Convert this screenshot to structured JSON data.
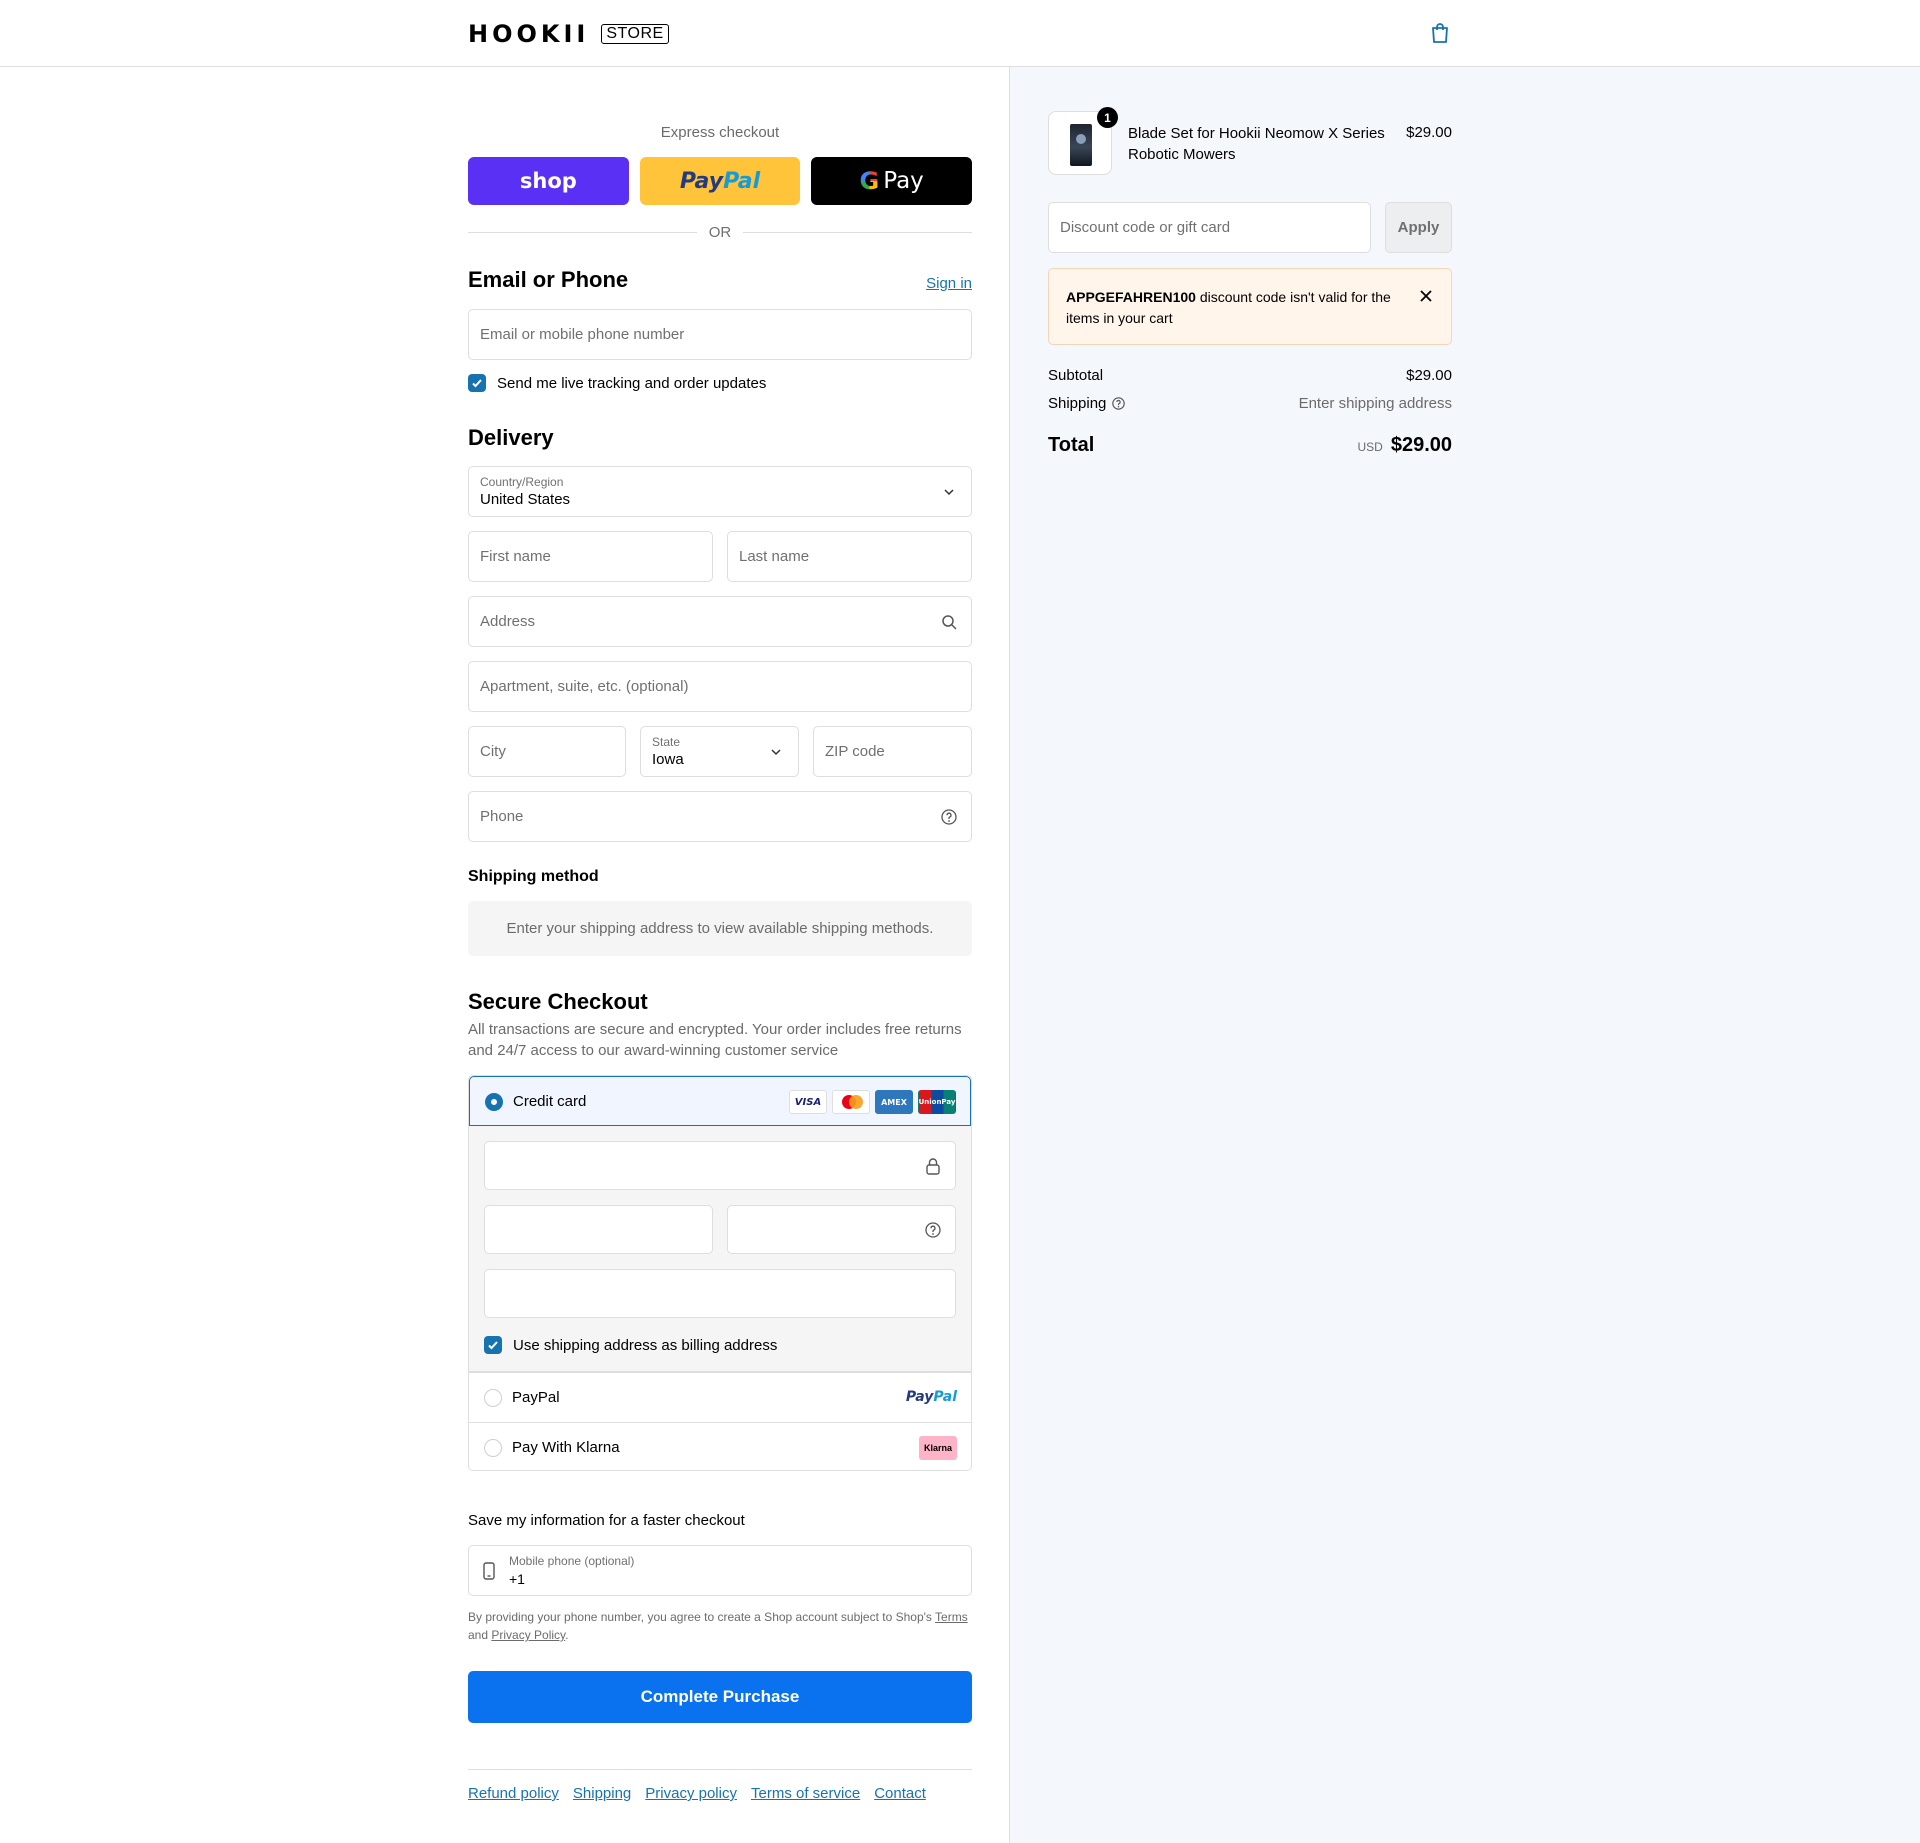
{
  "header": {
    "logo_text": "HOOKII",
    "store_label": "STORE",
    "cart_icon": "shopping-bag-icon"
  },
  "express": {
    "label": "Express checkout",
    "shop_label": "shop",
    "paypal_label_a": "Pay",
    "paypal_label_b": "Pal",
    "gpay_g": "G",
    "gpay_label": "Pay",
    "or": "OR"
  },
  "contact": {
    "heading": "Email or Phone",
    "sign_in": "Sign in",
    "email_placeholder": "Email or mobile phone number",
    "tracking_label": "Send me live tracking and order updates",
    "tracking_checked": true
  },
  "delivery": {
    "heading": "Delivery",
    "country_label": "Country/Region",
    "country_value": "United States",
    "first_name": "First name",
    "last_name": "Last name",
    "address": "Address",
    "apartment": "Apartment, suite, etc. (optional)",
    "city": "City",
    "state_label": "State",
    "state_value": "Iowa",
    "zip": "ZIP code",
    "phone": "Phone"
  },
  "shipping_method": {
    "heading": "Shipping method",
    "notice": "Enter your shipping address to view available shipping methods."
  },
  "payment": {
    "heading": "Secure Checkout",
    "description": "All transactions are secure and encrypted. Your order includes free returns and 24/7 access to our award-winning customer service",
    "credit_card_label": "Credit card",
    "card_logos": [
      "VISA",
      "Mastercard",
      "AMEX",
      "UnionPay"
    ],
    "visa_text": "VISA",
    "amex_text": "AMEX",
    "union_text": "UnionPay",
    "billing_label": "Use shipping address as billing address",
    "billing_checked": true,
    "paypal_label": "PayPal",
    "paypal_logo_a": "Pay",
    "paypal_logo_b": "Pal",
    "klarna_label": "Pay With Klarna",
    "klarna_logo": "Klarna"
  },
  "save_info": {
    "label": "Save my information for a faster checkout",
    "phone_label": "Mobile phone (optional)",
    "phone_value": "+1",
    "legal_text": "By providing your phone number, you agree to create a Shop account subject to Shop's",
    "terms": "Terms",
    "and": "and",
    "privacy": "Privacy Policy",
    "period": "."
  },
  "complete_button": "Complete Purchase",
  "footer_links": [
    "Refund policy",
    "Shipping",
    "Privacy policy",
    "Terms of service",
    "Contact"
  ],
  "summary": {
    "product_name": "Blade Set for Hookii Neomow X Series Robotic Mowers",
    "product_price": "$29.00",
    "quantity": "1",
    "discount_placeholder": "Discount code or gift card",
    "apply": "Apply",
    "alert_code": "APPGEFAHREN100",
    "alert_message": " discount code isn't valid for the items in your cart",
    "subtotal_label": "Subtotal",
    "subtotal_value": "$29.00",
    "shipping_label": "Shipping",
    "shipping_value": "Enter shipping address",
    "total_label": "Total",
    "currency": "USD",
    "total_value": "$29.00"
  },
  "colors": {
    "accent": "#1773b0",
    "primary_button": "#0a72ef",
    "shop_pay": "#5a31f4",
    "paypal": "#ffc439",
    "summary_bg": "#f4f7fc",
    "alert_bg": "#fff5eb"
  }
}
